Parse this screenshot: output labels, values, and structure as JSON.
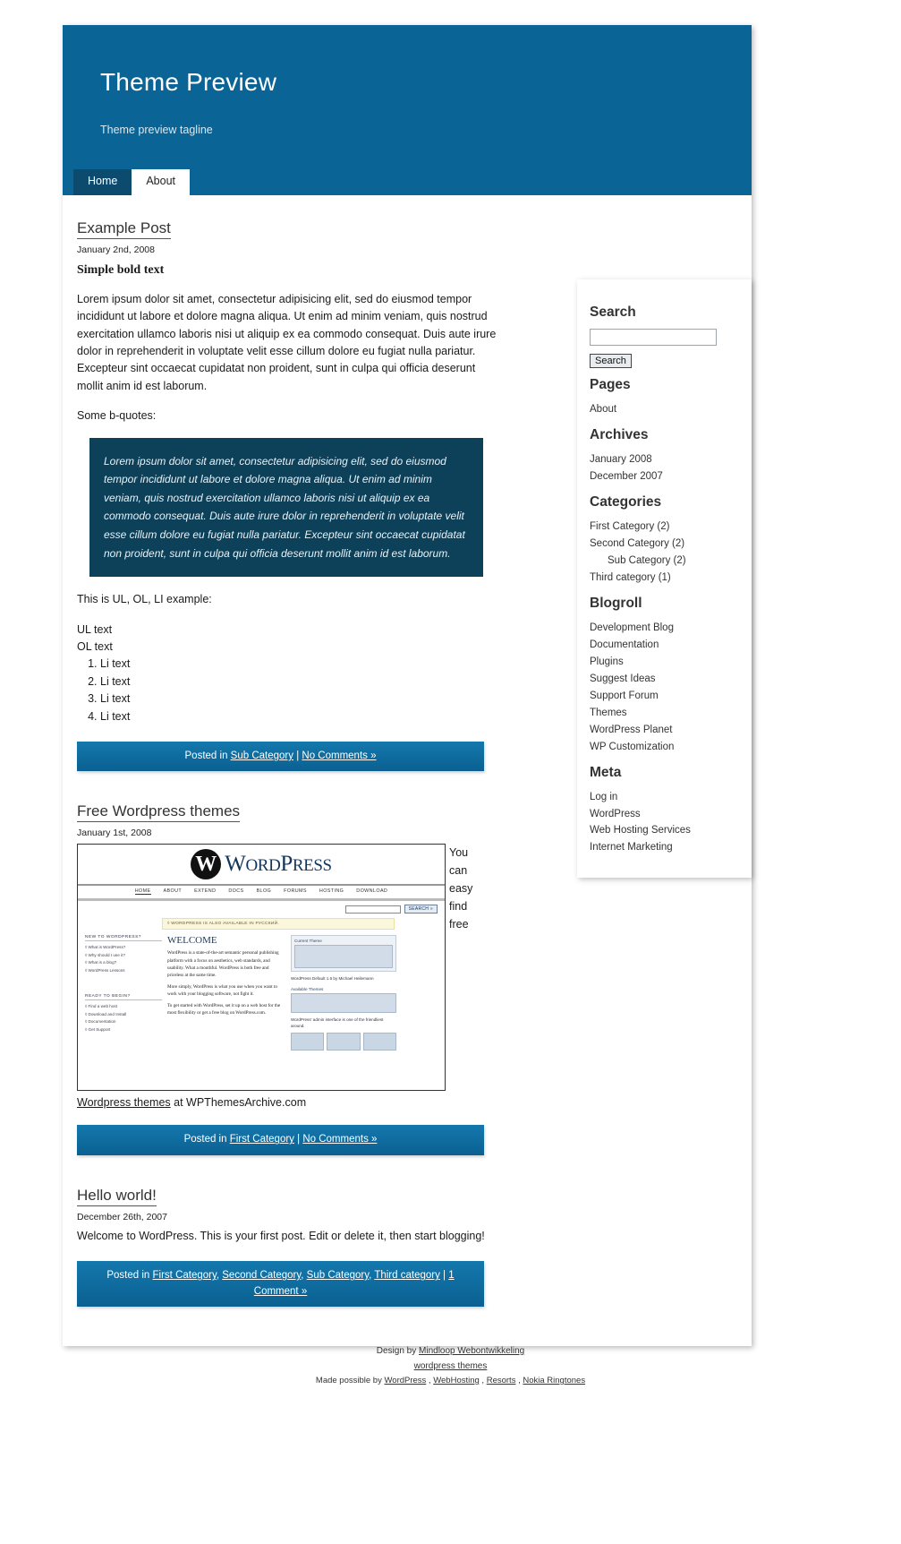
{
  "header": {
    "title": "Theme Preview",
    "tagline": "Theme preview tagline"
  },
  "nav": {
    "items": [
      {
        "label": "Home",
        "state": "current"
      },
      {
        "label": "About",
        "state": "other"
      }
    ]
  },
  "posts": [
    {
      "title": "Example Post",
      "date": "January 2nd, 2008",
      "bold_lead": "Simple bold text",
      "paragraph": "Lorem ipsum dolor sit amet, consectetur adipisicing elit, sed do eiusmod tempor incididunt ut labore et dolore magna aliqua. Ut enim ad minim veniam, quis nostrud exercitation ullamco laboris nisi ut aliquip ex ea commodo consequat. Duis aute irure dolor in reprehenderit in voluptate velit esse cillum dolore eu fugiat nulla pariatur. Excepteur sint occaecat cupidatat non proident, sunt in culpa qui officia deserunt mollit anim id est laborum.",
      "quote_intro": "Some b-quotes:",
      "blockquote": "Lorem ipsum dolor sit amet, consectetur adipisicing elit, sed do eiusmod tempor incididunt ut labore et dolore magna aliqua. Ut enim ad minim veniam, quis nostrud exercitation ullamco laboris nisi ut aliquip ex ea commodo consequat. Duis aute irure dolor in reprehenderit in voluptate velit esse cillum dolore eu fugiat nulla pariatur. Excepteur sint occaecat cupidatat non proident, sunt in culpa qui officia deserunt mollit anim id est laborum.",
      "list_intro": "This is UL, OL, LI example:",
      "ul_items": [
        "UL text",
        "OL text"
      ],
      "ol_items": [
        "Li text",
        "Li text",
        "Li text",
        "Li text"
      ],
      "meta_prefix": "Posted in ",
      "meta_categories": [
        "Sub Category"
      ],
      "meta_sep": " | ",
      "meta_comments": "No Comments »"
    },
    {
      "title": "Free Wordpress themes",
      "date": "January 1st, 2008",
      "side_text": "You can easy find free",
      "caption_link": "Wordpress themes",
      "caption_rest": " at WPThemesArchive.com",
      "meta_prefix": "Posted in ",
      "meta_categories": [
        "First Category"
      ],
      "meta_sep": " | ",
      "meta_comments": "No Comments »"
    },
    {
      "title": "Hello world!",
      "date": "December 26th, 2007",
      "paragraph": "Welcome to WordPress. This is your first post. Edit or delete it, then start blogging!",
      "meta_prefix": "Posted in ",
      "meta_categories": [
        "First Category",
        "Second Category",
        "Sub Category",
        "Third category"
      ],
      "meta_sep": " | ",
      "meta_comments": "1 Comment »"
    }
  ],
  "wp_shot": {
    "logo_mark": "W",
    "logo_word_a": "W",
    "logo_word_b": "ORD",
    "logo_word_c": "P",
    "logo_word_d": "RESS",
    "nav": [
      "HOME",
      "ABOUT",
      "EXTEND",
      "DOCS",
      "BLOG",
      "FORUMS",
      "HOSTING",
      "DOWNLOAD"
    ],
    "search_button": "SEARCH »",
    "notice": "◊ WORDPRESS IS ALSO AVAILABLE IN РУССКИЙ.",
    "col1_head1": "NEW TO WORDPRESS?",
    "col1_items1": [
      "◊ What is WordPress?",
      "◊ Why should I use it?",
      "◊ What is a blog?",
      "◊ WordPress Lessons"
    ],
    "col1_head2": "READY TO BEGIN?",
    "col1_items2": [
      "◊ Find a web host",
      "◊ Download and Install",
      "◊ Documentation",
      "◊ Get Support"
    ],
    "welcome": "WELCOME",
    "p1": "WordPress is a state-of-the-art semantic personal publishing platform with a focus on aesthetics, web standards, and usability. What a mouthful. WordPress is both free and priceless at the same time.",
    "p2": "More simply, WordPress is what you use when you want to work with your blogging software, not fight it.",
    "p3": "To get started with WordPress, set it up on a web host for the most flexibility or get a free blog on WordPress.com.",
    "current_theme": "Current Theme",
    "theme_caption": "WordPress Default 1.6 by Michael Heilemann",
    "available": "Available Themes",
    "admin_caption": "WordPress' admin interface is one of the friendliest around."
  },
  "sidebar": {
    "widgets": [
      {
        "title": "Search",
        "type": "search",
        "input_value": "",
        "input_placeholder": "",
        "button_label": "Search"
      },
      {
        "title": "Pages",
        "type": "list",
        "items": [
          {
            "label": "About",
            "sub": false
          }
        ]
      },
      {
        "title": "Archives",
        "type": "list",
        "items": [
          {
            "label": "January 2008",
            "sub": false
          },
          {
            "label": "December 2007",
            "sub": false
          }
        ]
      },
      {
        "title": "Categories",
        "type": "list",
        "items": [
          {
            "label": "First Category (2)",
            "sub": false
          },
          {
            "label": "Second Category (2)",
            "sub": false
          },
          {
            "label": "Sub Category (2)",
            "sub": true
          },
          {
            "label": "Third category (1)",
            "sub": false
          }
        ]
      },
      {
        "title": "Blogroll",
        "type": "list",
        "items": [
          {
            "label": "Development Blog",
            "sub": false
          },
          {
            "label": "Documentation",
            "sub": false
          },
          {
            "label": "Plugins",
            "sub": false
          },
          {
            "label": "Suggest Ideas",
            "sub": false
          },
          {
            "label": "Support Forum",
            "sub": false
          },
          {
            "label": "Themes",
            "sub": false
          },
          {
            "label": "WordPress Planet",
            "sub": false
          },
          {
            "label": "WP Customization",
            "sub": false
          }
        ]
      },
      {
        "title": "Meta",
        "type": "list",
        "items": [
          {
            "label": "Log in",
            "sub": false
          },
          {
            "label": "WordPress",
            "sub": false
          },
          {
            "label": "Web Hosting Services",
            "sub": false
          },
          {
            "label": "Internet Marketing",
            "sub": false
          }
        ]
      }
    ]
  },
  "footer": {
    "line1_prefix": "Design by ",
    "line1_link": "Mindloop Webontwikkeling",
    "line2_link": "wordpress themes",
    "line3_prefix": "Made possible by ",
    "line3_links": [
      "WordPress",
      "WebHosting",
      "Resorts",
      "Nokia Ringtones"
    ],
    "line3_sep": " , "
  },
  "colors": {
    "header_blue": "#0a6496",
    "tab_active": "#0d4b6e",
    "quote_bg": "#0d4059",
    "meta_bar": "#1478ad"
  }
}
